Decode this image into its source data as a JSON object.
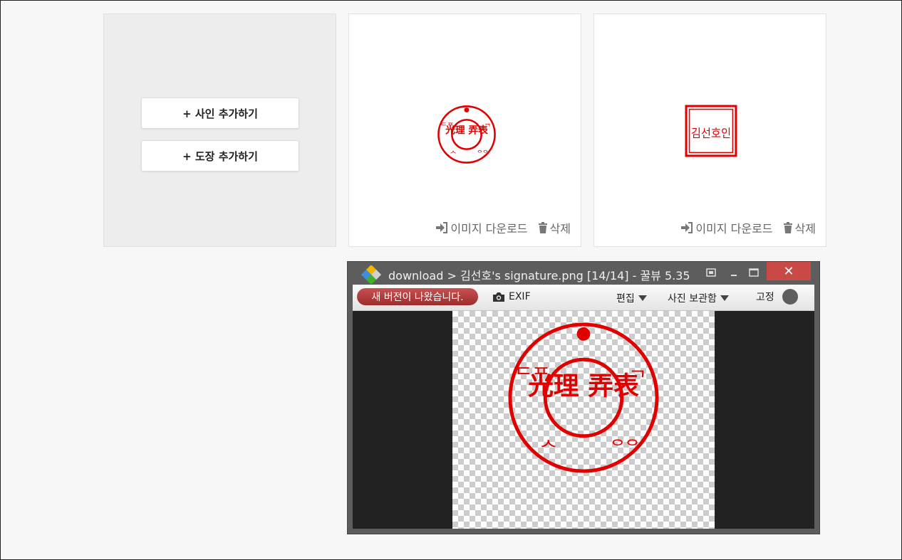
{
  "add_panel": {
    "add_signature_label": "+ 사인 추가하기",
    "add_stamp_label": "+ 도장 추가하기"
  },
  "cards": [
    {
      "download_label": "이미지 다운로드",
      "delete_label": "삭제",
      "seal_text": {
        "center": "光理 弄表",
        "ring_left": "ᄃᄑ",
        "ring_right": "ᄀ",
        "ring_bottom": "ᄉ",
        "ring_br": "ᄋᄋ"
      }
    },
    {
      "download_label": "이미지 다운로드",
      "delete_label": "삭제",
      "seal_text": "김선호인"
    }
  ],
  "viewer": {
    "title": "download  >  김선호's signature.png [14/14] - 꿀뷰 5.35",
    "toolbar": {
      "new_version": "새 버전이 나왔습니다.",
      "exif": "EXIF",
      "edit": "편집",
      "photo_storage": "사진 보관함",
      "pin": "고정"
    },
    "window_buttons": {
      "close": "✕"
    },
    "seal_text": {
      "center": "光理 弄表",
      "ring_left": "ᄃᄑ",
      "ring_right": "ᄀ",
      "ring_bottom": "ᄉ",
      "ring_br": "ᄋᄋ"
    }
  },
  "colors": {
    "seal_red": "#e00000",
    "close_red": "#c94a44",
    "new_version_red": "#b13c3c"
  },
  "icons": [
    "download-icon",
    "trash-icon",
    "camera-icon",
    "app-logo-icon",
    "minimize-icon",
    "maximize-icon",
    "restore-icon",
    "close-icon"
  ]
}
